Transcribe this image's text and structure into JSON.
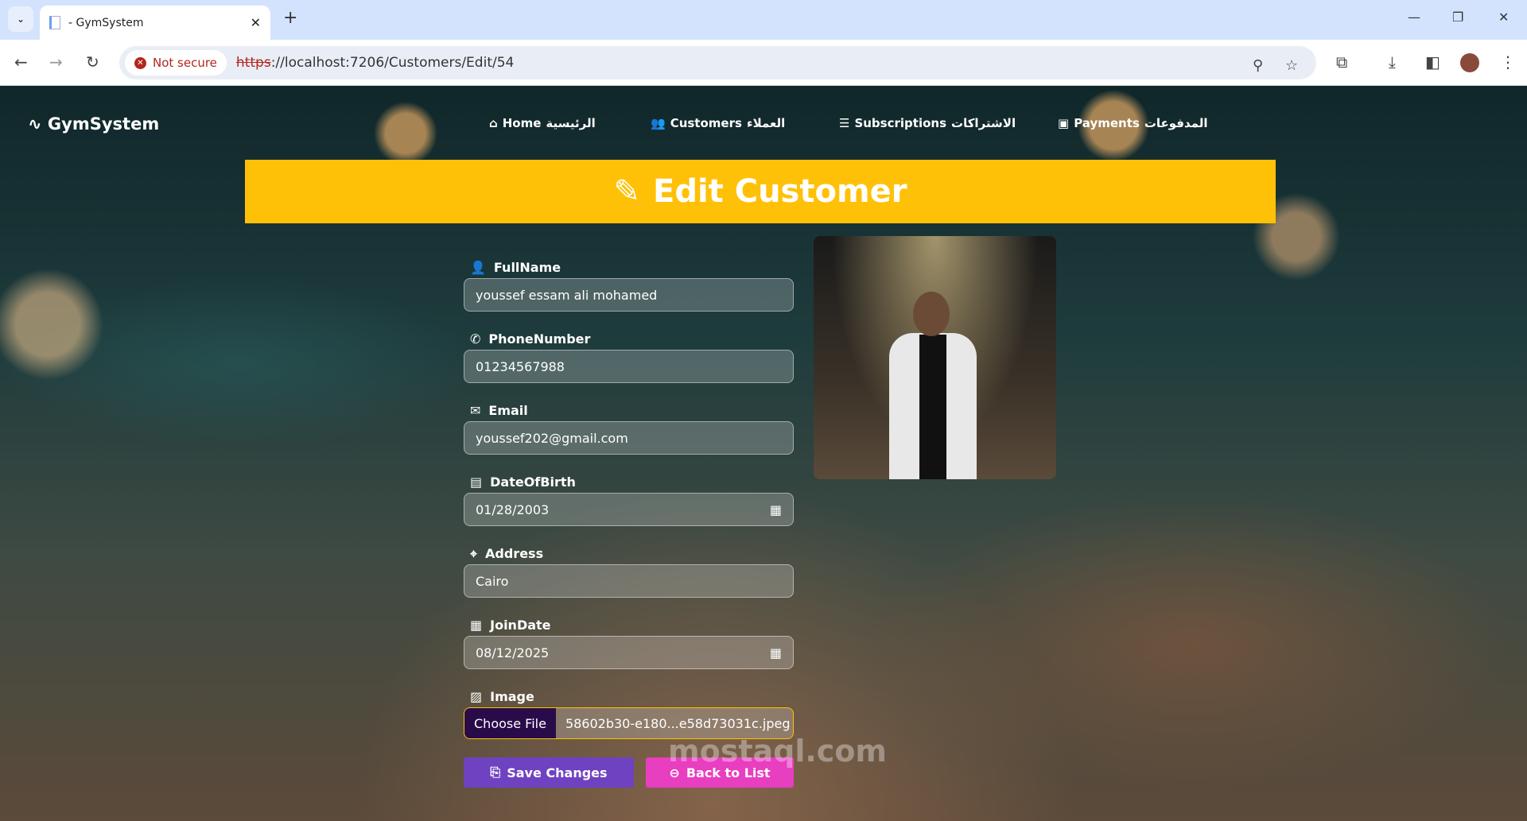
{
  "browser": {
    "tab_title": "- GymSystem",
    "security_label": "Not secure",
    "url_scheme": "https",
    "url_rest": "://localhost:7206/Customers/Edit/54"
  },
  "nav": {
    "brand": "GymSystem",
    "items": [
      {
        "label": "Home",
        "arabic": "الرئيسية"
      },
      {
        "label": "Customers",
        "arabic": "العملاء"
      },
      {
        "label": "Subscriptions",
        "arabic": "الاشتراكات"
      },
      {
        "label": "Payments",
        "arabic": "المدفوعات"
      }
    ]
  },
  "banner": {
    "title": "Edit Customer"
  },
  "form": {
    "fullname_label": "FullName",
    "fullname": "youssef essam ali mohamed",
    "phone_label": "PhoneNumber",
    "phone": "01234567988",
    "email_label": "Email",
    "email": "youssef202@gmail.com",
    "dob_label": "DateOfBirth",
    "dob": "01/28/2003",
    "address_label": "Address",
    "address": "Cairo",
    "join_label": "JoinDate",
    "join": "08/12/2025",
    "image_label": "Image",
    "choose_file": "Choose File",
    "file_name": "58602b30-e180...e58d73031c.jpeg",
    "save": "Save Changes",
    "back": "Back to List"
  },
  "watermark": "mostaql.com"
}
